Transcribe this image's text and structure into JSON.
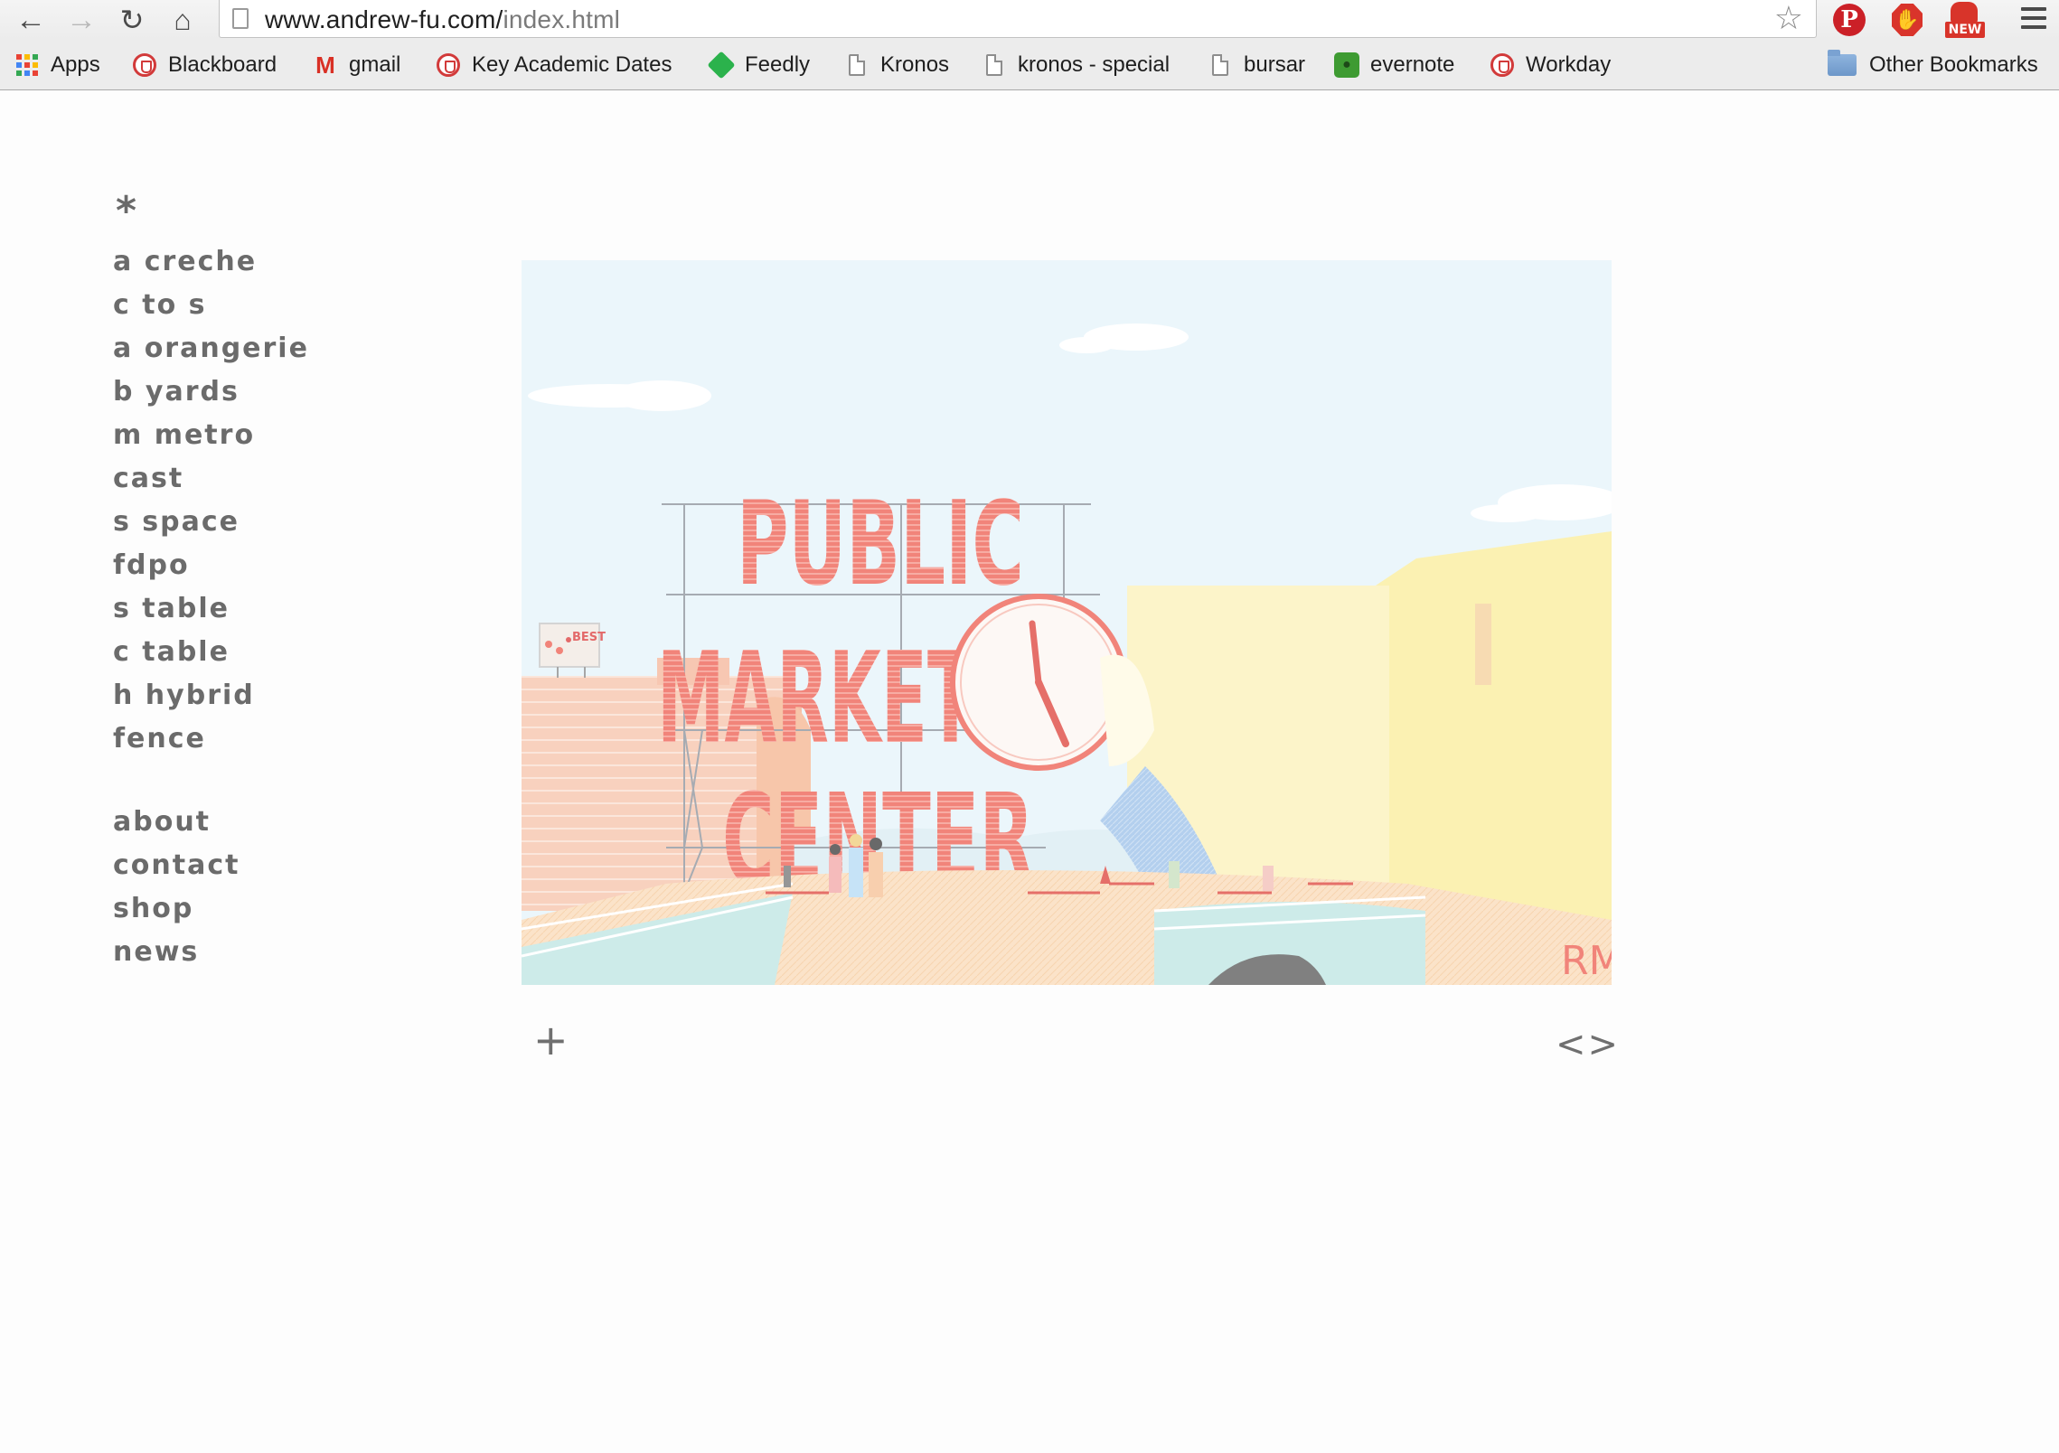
{
  "browser": {
    "url_host": "www.andrew-fu.com/",
    "url_path": "index.html",
    "bookmarks": [
      {
        "label": "Apps",
        "icon": "apps-grid-icon"
      },
      {
        "label": "Blackboard",
        "icon": "shield-icon"
      },
      {
        "label": "gmail",
        "icon": "gmail-icon"
      },
      {
        "label": "Key Academic Dates",
        "icon": "shield-icon"
      },
      {
        "label": "Feedly",
        "icon": "feedly-icon"
      },
      {
        "label": "Kronos",
        "icon": "document-icon"
      },
      {
        "label": "kronos - special",
        "icon": "document-icon"
      },
      {
        "label": "bursar",
        "icon": "document-icon"
      },
      {
        "label": "evernote",
        "icon": "evernote-icon"
      },
      {
        "label": "Workday",
        "icon": "shield-icon"
      }
    ],
    "other_bookmarks": "Other Bookmarks",
    "ext_badge": "NEW"
  },
  "site": {
    "asterisk": "*",
    "projects": [
      "a creche",
      "c to s",
      "a orangerie",
      "b yards",
      "m metro",
      "cast",
      "s space",
      "fdpo",
      "s table",
      "c table",
      "h hybrid",
      "fence"
    ],
    "info": [
      "about",
      "contact",
      "shop",
      "news"
    ],
    "controls": {
      "expand": "+",
      "prev_next": "<>"
    }
  },
  "hero": {
    "sign_line1": "PUBLIC",
    "sign_line2": "MARKET",
    "sign_line3": "CENTER",
    "billboard": "BEST",
    "corner_text": "RME"
  },
  "colors": {
    "sign": "#f07468",
    "sky": "#e9f5fb",
    "nav_text": "#6b6b6b",
    "building_left": "#f8cbb6",
    "building_right": "#fbefa8"
  }
}
